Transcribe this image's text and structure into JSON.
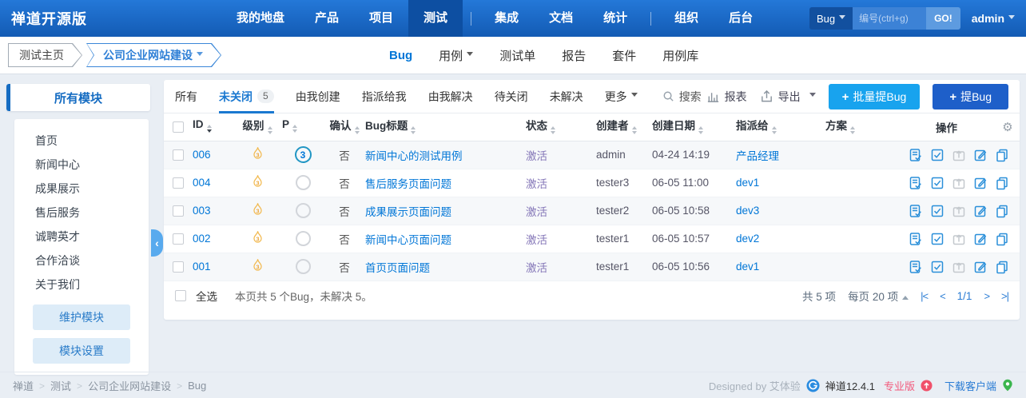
{
  "topnav": {
    "logo": "禅道开源版",
    "items": [
      {
        "label": "我的地盘"
      },
      {
        "label": "产品"
      },
      {
        "label": "项目"
      },
      {
        "label": "测试",
        "active": true
      },
      {
        "label": "集成"
      },
      {
        "label": "文档"
      },
      {
        "label": "统计"
      },
      {
        "label": "组织"
      },
      {
        "label": "后台"
      }
    ],
    "search": {
      "scope": "Bug",
      "placeholder": "编号(ctrl+g)",
      "go_label": "GO!"
    },
    "user": "admin"
  },
  "subnav": {
    "breadcrumb": [
      {
        "label": "测试主页"
      },
      {
        "label": "公司企业网站建设"
      }
    ],
    "tabs": [
      {
        "label": "Bug",
        "active": true
      },
      {
        "label": "用例"
      },
      {
        "label": "测试单"
      },
      {
        "label": "报告"
      },
      {
        "label": "套件"
      },
      {
        "label": "用例库"
      }
    ]
  },
  "sidebar": {
    "title": "所有模块",
    "items": [
      "首页",
      "新闻中心",
      "成果展示",
      "售后服务",
      "诚聘英才",
      "合作洽谈",
      "关于我们"
    ],
    "buttons": [
      "维护模块",
      "模块设置"
    ]
  },
  "toolbar": {
    "filters": [
      {
        "label": "所有"
      },
      {
        "label": "未关闭",
        "badge": "5",
        "active": true
      },
      {
        "label": "由我创建"
      },
      {
        "label": "指派给我"
      },
      {
        "label": "由我解决"
      },
      {
        "label": "待关闭"
      },
      {
        "label": "未解决"
      },
      {
        "label": "更多"
      }
    ],
    "search_label": "搜索",
    "report_label": "报表",
    "export_label": "导出",
    "batch_button": "批量提Bug",
    "add_button": "提Bug"
  },
  "table": {
    "columns": [
      "ID",
      "级别",
      "P",
      "确认",
      "Bug标题",
      "状态",
      "创建者",
      "创建日期",
      "指派给",
      "方案",
      "操作"
    ],
    "rows": [
      {
        "id": "006",
        "severity": "3",
        "priority": "3",
        "confirmed": "否",
        "title": "新闻中心的测试用例",
        "status": "激活",
        "creator": "admin",
        "date": "04-24 14:19",
        "assignee": "产品经理",
        "plan": ""
      },
      {
        "id": "004",
        "severity": "3",
        "priority": "",
        "confirmed": "否",
        "title": "售后服务页面问题",
        "status": "激活",
        "creator": "tester3",
        "date": "06-05 11:00",
        "assignee": "dev1",
        "plan": ""
      },
      {
        "id": "003",
        "severity": "3",
        "priority": "",
        "confirmed": "否",
        "title": "成果展示页面问题",
        "status": "激活",
        "creator": "tester2",
        "date": "06-05 10:58",
        "assignee": "dev3",
        "plan": ""
      },
      {
        "id": "002",
        "severity": "3",
        "priority": "",
        "confirmed": "否",
        "title": "新闻中心页面问题",
        "status": "激活",
        "creator": "tester1",
        "date": "06-05 10:57",
        "assignee": "dev2",
        "plan": ""
      },
      {
        "id": "001",
        "severity": "3",
        "priority": "",
        "confirmed": "否",
        "title": "首页页面问题",
        "status": "激活",
        "creator": "tester1",
        "date": "06-05 10:56",
        "assignee": "dev1",
        "plan": ""
      }
    ]
  },
  "pager": {
    "select_all": "全选",
    "summary": "本页共 5 个Bug，未解决 5。",
    "total": "共 5 项",
    "per_page": "每页 20 项",
    "page": "1/1",
    "first": "|<",
    "prev": "<",
    "next": ">",
    "last": ">|"
  },
  "footer": {
    "breadcrumb": [
      "禅道",
      "测试",
      "公司企业网站建设",
      "Bug"
    ],
    "designed_by": "Designed by 艾体验",
    "version": "禅道12.4.1",
    "edition": "专业版",
    "download": "下载客户端"
  },
  "colors": {
    "navbar_top": "#2478d8",
    "navbar_bottom": "#135bb4",
    "accent_blue": "#0076d7",
    "batch_button": "#18a3ee",
    "add_button": "#1e5fc9",
    "status_active": "#8577b8",
    "edition_red": "#f25a7c",
    "download_green": "#3bb64e"
  }
}
